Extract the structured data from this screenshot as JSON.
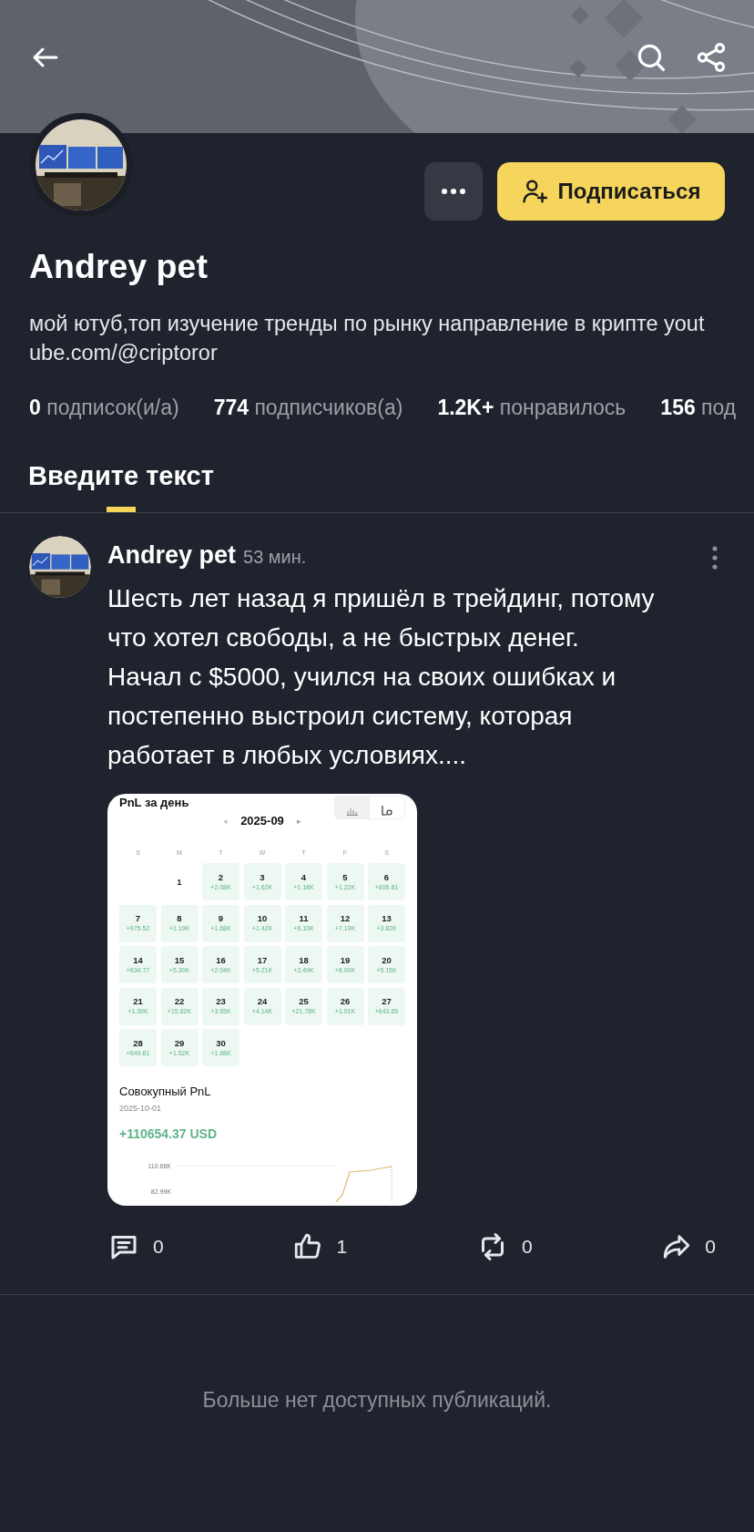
{
  "profile": {
    "name": "Andrey pet",
    "bio_lines": [
      "мой ютуб,топ изучение тренды по рынку направление в крипте yout",
      "ube.com/@criptoror"
    ],
    "stats": [
      {
        "text": "**0** подписок(и/а)"
      },
      {
        "text": "**774** подписчиков(а)"
      },
      {
        "text": "**1.2K+** понравилось"
      },
      {
        "text": "**156** под"
      }
    ],
    "subscribe_label": "Подписаться"
  },
  "tabs": [
    {
      "label": "Введите текст",
      "selected": true
    }
  ],
  "posts": [
    {
      "author": "Andrey pet",
      "time": "53 мин.",
      "text": "Шесть лет назад я пришёл в трейдинг, потому что хотел свободы, а не быстрых денег. Начал с $5000, учился на своих ошибках и постепенно выстроил систему, которая работает в любых условиях....",
      "attachment": {
        "title": "PnL за день",
        "month": "2025-09",
        "prev_arrow": "◂",
        "next_arrow": "▸",
        "weekdays": [
          "S",
          "M",
          "T",
          "W",
          "T",
          "F",
          "S"
        ],
        "weeks": [
          [
            {
              "day": "1"
            },
            {
              "day": "2",
              "pnl": "+2.08K"
            },
            {
              "day": "3",
              "pnl": "+1.62K"
            },
            {
              "day": "4",
              "pnl": "+1.18K"
            },
            {
              "day": "5",
              "pnl": "+1.22K"
            },
            {
              "day": "6",
              "pnl": "+606.81"
            }
          ],
          [
            {
              "day": "7",
              "pnl": "+975.52"
            },
            {
              "day": "8",
              "pnl": "+1.19K"
            },
            {
              "day": "9",
              "pnl": "+1.68K"
            },
            {
              "day": "10",
              "pnl": "+1.42K"
            },
            {
              "day": "11",
              "pnl": "+6.10K"
            },
            {
              "day": "12",
              "pnl": "+7.19K"
            },
            {
              "day": "13",
              "pnl": "+3.82K"
            }
          ],
          [
            {
              "day": "14",
              "pnl": "+634.77"
            },
            {
              "day": "15",
              "pnl": "+5.30K"
            },
            {
              "day": "16",
              "pnl": "+2.04K"
            },
            {
              "day": "17",
              "pnl": "+5.21K"
            },
            {
              "day": "18",
              "pnl": "+2.49K"
            },
            {
              "day": "19",
              "pnl": "+8.00K"
            },
            {
              "day": "20",
              "pnl": "+5.15K"
            }
          ],
          [
            {
              "day": "21",
              "pnl": "+1.39K"
            },
            {
              "day": "22",
              "pnl": "+15.82K"
            },
            {
              "day": "23",
              "pnl": "+3.65K"
            },
            {
              "day": "24",
              "pnl": "+4.14K"
            },
            {
              "day": "25",
              "pnl": "+21.78K"
            },
            {
              "day": "26",
              "pnl": "+1.01K"
            },
            {
              "day": "27",
              "pnl": "+643.65"
            }
          ],
          [
            {
              "day": "28",
              "pnl": "+649.81"
            },
            {
              "day": "29",
              "pnl": "+1.52K"
            },
            {
              "day": "30",
              "pnl": "+1.68K"
            }
          ]
        ],
        "summary_title": "Совокупный PnL",
        "summary_date": "2025-10-01",
        "summary_total": "+110654.37 USD",
        "axis_labels": [
          "110.66K",
          "82.99K"
        ]
      },
      "actions": [
        {
          "kind": "comment",
          "count": "0"
        },
        {
          "kind": "like",
          "count": "1"
        },
        {
          "kind": "repost",
          "count": "0"
        },
        {
          "kind": "share",
          "count": "0"
        }
      ]
    }
  ],
  "footer": "Больше нет доступных публикаций."
}
